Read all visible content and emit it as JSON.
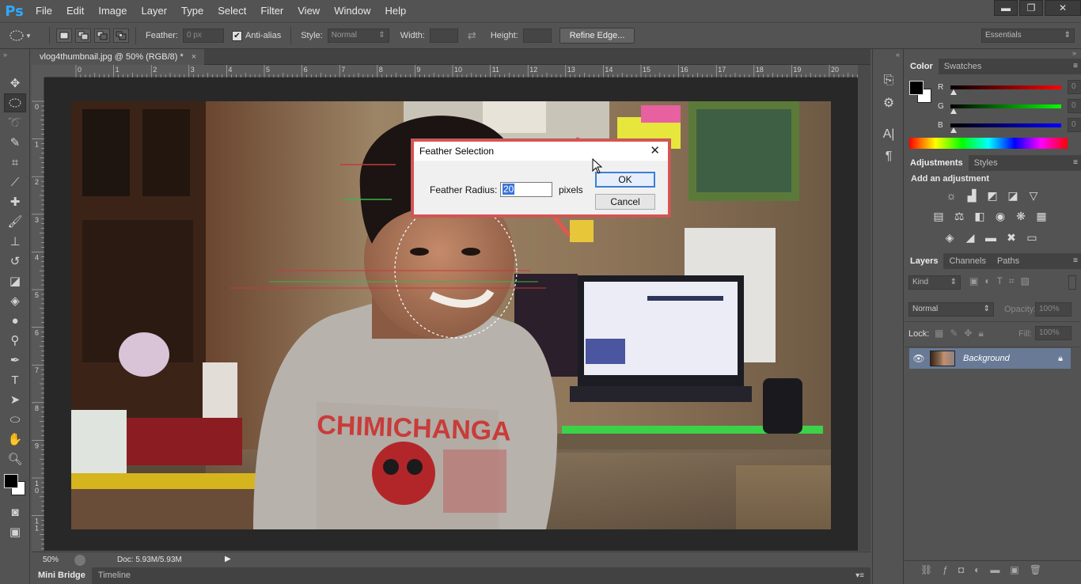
{
  "app": {
    "logo": "Ps"
  },
  "menu": [
    "File",
    "Edit",
    "Image",
    "Layer",
    "Type",
    "Select",
    "Filter",
    "View",
    "Window",
    "Help"
  ],
  "window_controls": {
    "minimize": "▬",
    "restore": "❐",
    "close": "✕"
  },
  "options": {
    "feather_label": "Feather:",
    "feather_value": "0 px",
    "antialias_label": "Anti-alias",
    "antialias_checked": true,
    "style_label": "Style:",
    "style_value": "Normal",
    "width_label": "Width:",
    "height_label": "Height:",
    "refine_edge": "Refine Edge...",
    "workspace": "Essentials"
  },
  "document": {
    "tab_title": "vlog4thumbnail.jpg @ 50% (RGB/8) *",
    "tab_close": "×",
    "ruler_h": [
      "0",
      "1",
      "2",
      "3",
      "4",
      "5",
      "6",
      "7",
      "8",
      "9",
      "10",
      "11",
      "12",
      "13",
      "14",
      "15",
      "16",
      "17",
      "18",
      "19",
      "20"
    ],
    "ruler_v": [
      "0",
      "1",
      "2",
      "3",
      "4",
      "5",
      "6",
      "7",
      "8",
      "9",
      "1\n0",
      "1\n1"
    ]
  },
  "status": {
    "zoom": "50%",
    "doc_size": "Doc: 5.93M/5.93M"
  },
  "bottom_tabs": [
    "Mini Bridge",
    "Timeline"
  ],
  "color_panel": {
    "tabs": [
      "Color",
      "Swatches"
    ],
    "channels": [
      {
        "label": "R",
        "value": "0",
        "gradient_end": "#ff0000"
      },
      {
        "label": "G",
        "value": "0",
        "gradient_end": "#00ff00"
      },
      {
        "label": "B",
        "value": "0",
        "gradient_end": "#0000ff"
      }
    ],
    "foreground": "#000000",
    "background": "#ffffff"
  },
  "adjustments_panel": {
    "tabs": [
      "Adjustments",
      "Styles"
    ],
    "title": "Add an adjustment"
  },
  "layers_panel": {
    "tabs": [
      "Layers",
      "Channels",
      "Paths"
    ],
    "kind_label": "Kind",
    "blend_mode": "Normal",
    "opacity_label": "Opacity:",
    "opacity_value": "100%",
    "lock_label": "Lock:",
    "fill_label": "Fill:",
    "fill_value": "100%",
    "layers": [
      {
        "name": "Background",
        "visible": true,
        "locked": true
      }
    ]
  },
  "dialog": {
    "title": "Feather Selection",
    "field_label": "Feather Radius:",
    "field_value": "20",
    "unit": "pixels",
    "ok": "OK",
    "cancel": "Cancel",
    "close": "✕"
  },
  "colors": {
    "ui_bg": "#535353",
    "panel_dark": "#424242",
    "highlight_layer": "#687a96",
    "annotation_arrow": "#e2574c",
    "ps_blue": "#31a8ff"
  }
}
